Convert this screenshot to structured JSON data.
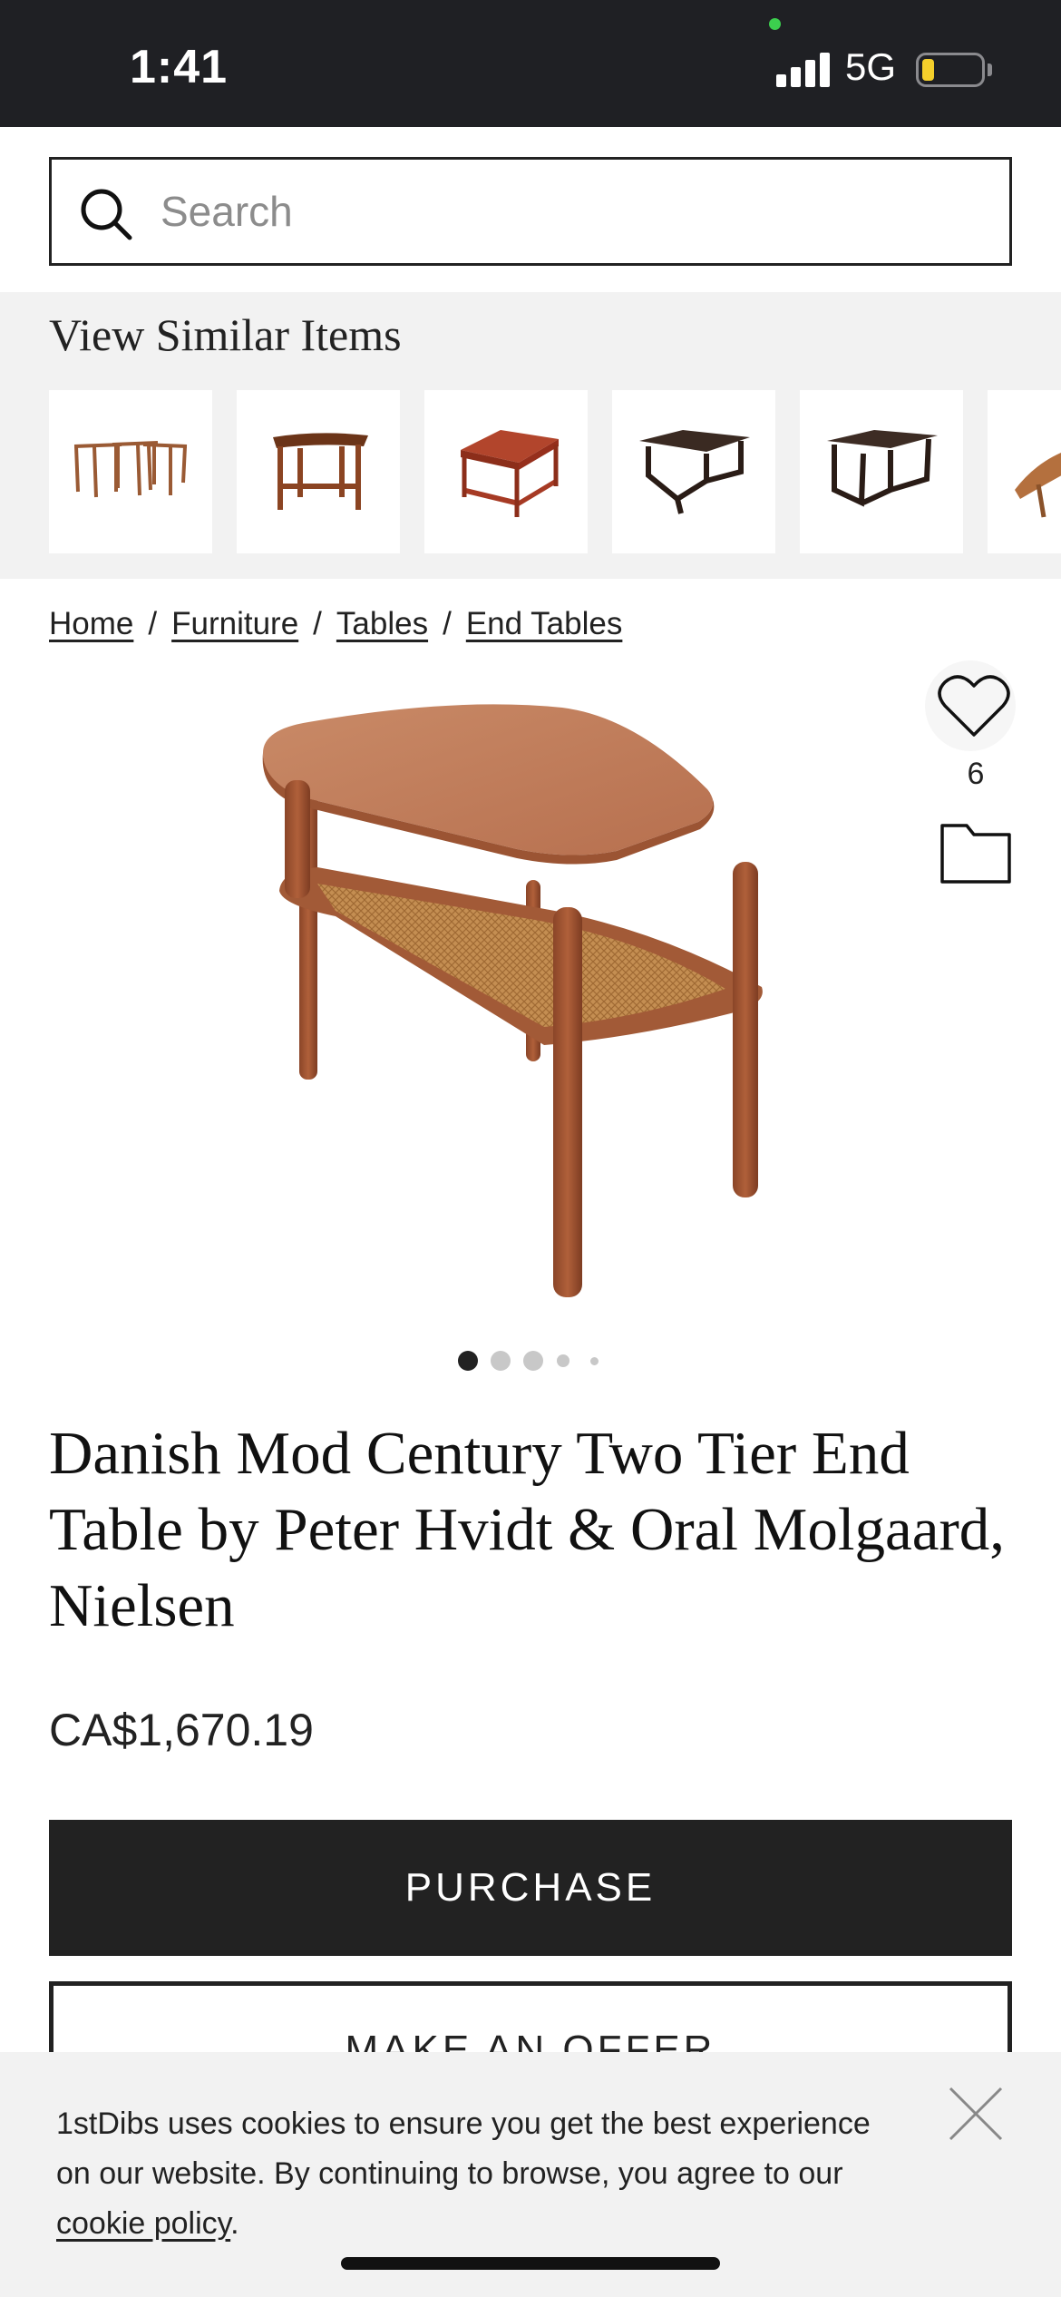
{
  "status_bar": {
    "time": "1:41",
    "network": "5G",
    "battery_level": 0.2,
    "colors": {
      "background": "#1f2024",
      "battery_fill": "#f4cf2b",
      "dot": "#3ccf4e"
    }
  },
  "search": {
    "placeholder": "Search",
    "icon": "search-icon"
  },
  "similar_items": {
    "title": "View Similar Items",
    "items": [
      {
        "icon": "nesting-tables-thumbnail"
      },
      {
        "icon": "side-table-thumbnail"
      },
      {
        "icon": "two-tier-red-table-thumbnail"
      },
      {
        "icon": "dark-coffee-table-thumbnail"
      },
      {
        "icon": "dark-square-table-thumbnail"
      },
      {
        "icon": "partial-table-thumbnail"
      }
    ]
  },
  "breadcrumb": {
    "items": [
      "Home",
      "Furniture",
      "Tables",
      "End Tables"
    ],
    "separator": "/"
  },
  "favorites": {
    "count": "6",
    "heart_icon": "heart-icon",
    "folder_icon": "folder-icon"
  },
  "gallery": {
    "image": "two-tier-end-table-photo",
    "dots_total": 5,
    "active_index": 0
  },
  "product": {
    "title": "Danish Mod Century Two Tier End Table by Peter Hvidt & Oral Molgaard, Nielsen",
    "price": "CA$1,670.19"
  },
  "actions": {
    "purchase_label": "PURCHASE",
    "offer_label": "MAKE AN OFFER"
  },
  "cookie_banner": {
    "text": "1stDibs uses cookies to ensure you get the best experience on our website. By continuing to browse, you agree to our ",
    "link_text": "cookie policy",
    "trailing": ".",
    "close_icon": "close-icon"
  }
}
